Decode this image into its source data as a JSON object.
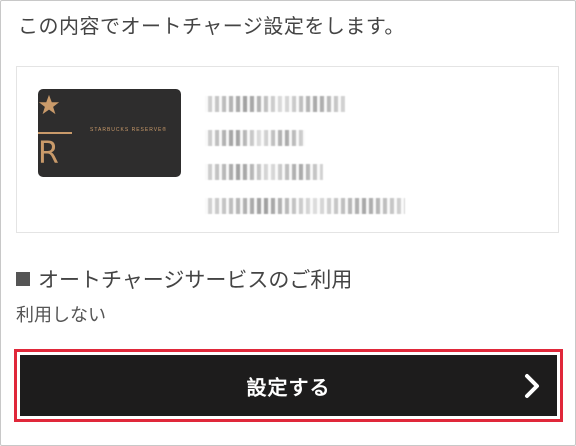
{
  "intro_text": "この内容でオートチャージ設定をします。",
  "card": {
    "brand_text": "STARBUCKS RESERVE®",
    "brand_letter": "R",
    "details_redacted": [
      "カードニックネーム：",
      "マイカード",
      "カード番号：",
      "●●●● ●●●● ●●●● ●●●●"
    ]
  },
  "auto_charge_section": {
    "title": "オートチャージサービスのご利用",
    "value": "利用しない"
  },
  "submit": {
    "label": "設定する",
    "icon": "chevron-right-icon"
  },
  "colors": {
    "button_bg": "#1d1c1c",
    "highlight_border": "#e0283a",
    "card_bg": "#2e2d2d",
    "card_accent": "#c99a6a"
  }
}
